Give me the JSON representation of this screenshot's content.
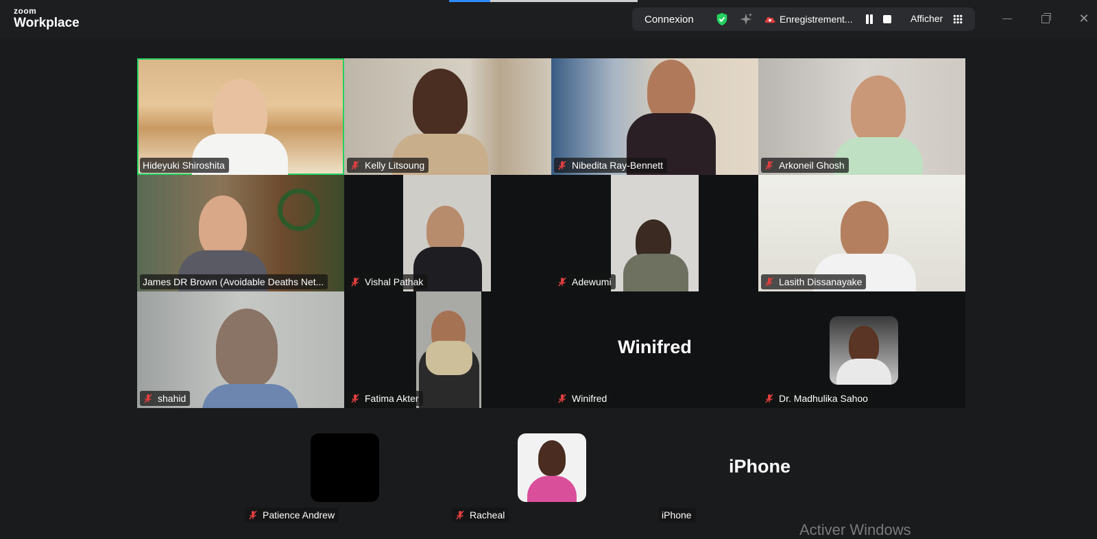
{
  "app": {
    "brand_top": "zoom",
    "brand_bottom": "Workplace"
  },
  "toolbar": {
    "connection_label": "Connexion",
    "recording_label": "Enregistrement...",
    "view_label": "Afficher"
  },
  "participants": [
    {
      "name": "Hideyuki Shiroshita",
      "active_speaker": true,
      "muted": false
    },
    {
      "name": "Kelly Litsoung",
      "muted": true
    },
    {
      "name": "Nibedita Ray-Bennett",
      "muted": true
    },
    {
      "name": "Arkoneil Ghosh",
      "muted": true
    },
    {
      "name": "James DR Brown (Avoidable Deaths Net...",
      "muted": false
    },
    {
      "name": "Vishal Pathak",
      "muted": true
    },
    {
      "name": "Adewumi",
      "muted": true
    },
    {
      "name": "Lasith Dissanayake",
      "muted": true
    },
    {
      "name": "shahid",
      "muted": true
    },
    {
      "name": "Fatima Akter",
      "muted": true
    },
    {
      "name": "Winifred",
      "muted": true,
      "display_text": "Winifred"
    },
    {
      "name": "Dr. Madhulika Sahoo",
      "muted": true
    },
    {
      "name": "Patience Andrew",
      "muted": true
    },
    {
      "name": "Racheal",
      "muted": true
    },
    {
      "name": "iPhone",
      "muted": false,
      "display_text": "iPhone"
    }
  ],
  "watermark": "Activer Windows",
  "colors": {
    "active_speaker": "#23d160",
    "muted_icon": "#e03e3e",
    "secure": "#23d160",
    "record": "#e03e3e"
  }
}
